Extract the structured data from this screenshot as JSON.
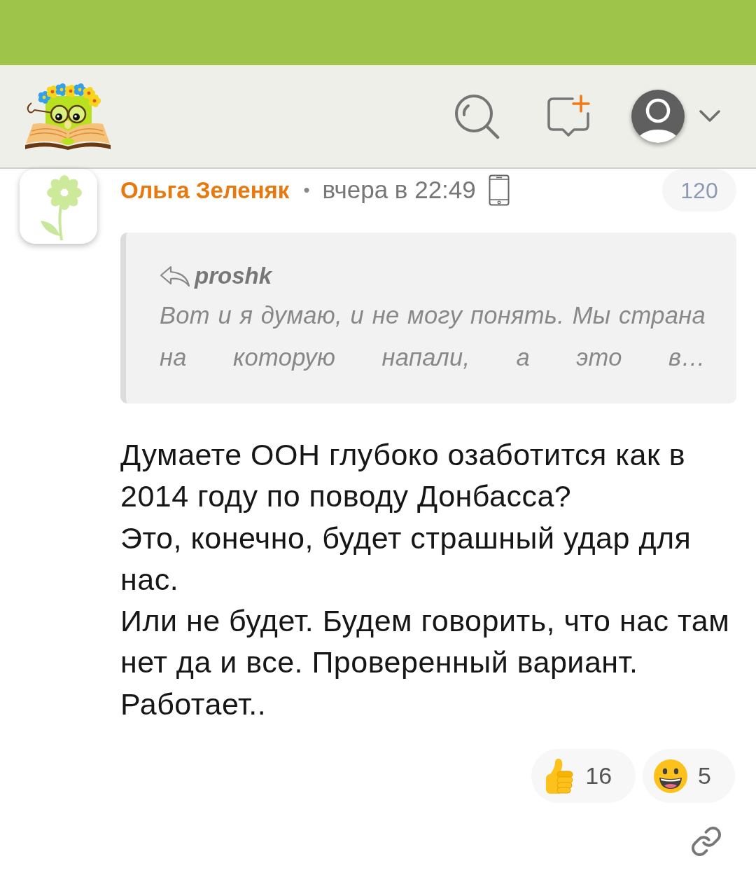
{
  "comment": {
    "author": "Ольга Зеленяк",
    "separator": "•",
    "time": "вчера в 22:49",
    "rating": "120",
    "quote": {
      "author": "proshk",
      "text": "Вот и я думаю, и не могу понять. Мы страна на которую напали, а это в…"
    },
    "text": "Думаете ООН глубоко озаботится как в 2014 году по поводу Донбасса?\nЭто, конечно, будет страшный удар для нас.\nИли не будет. Будем говорить, что нас там нет да и все. Проверенный вариант.\nРаботает..",
    "reactions": [
      {
        "kind": "like",
        "count": "16"
      },
      {
        "kind": "smile",
        "count": "5"
      }
    ]
  }
}
